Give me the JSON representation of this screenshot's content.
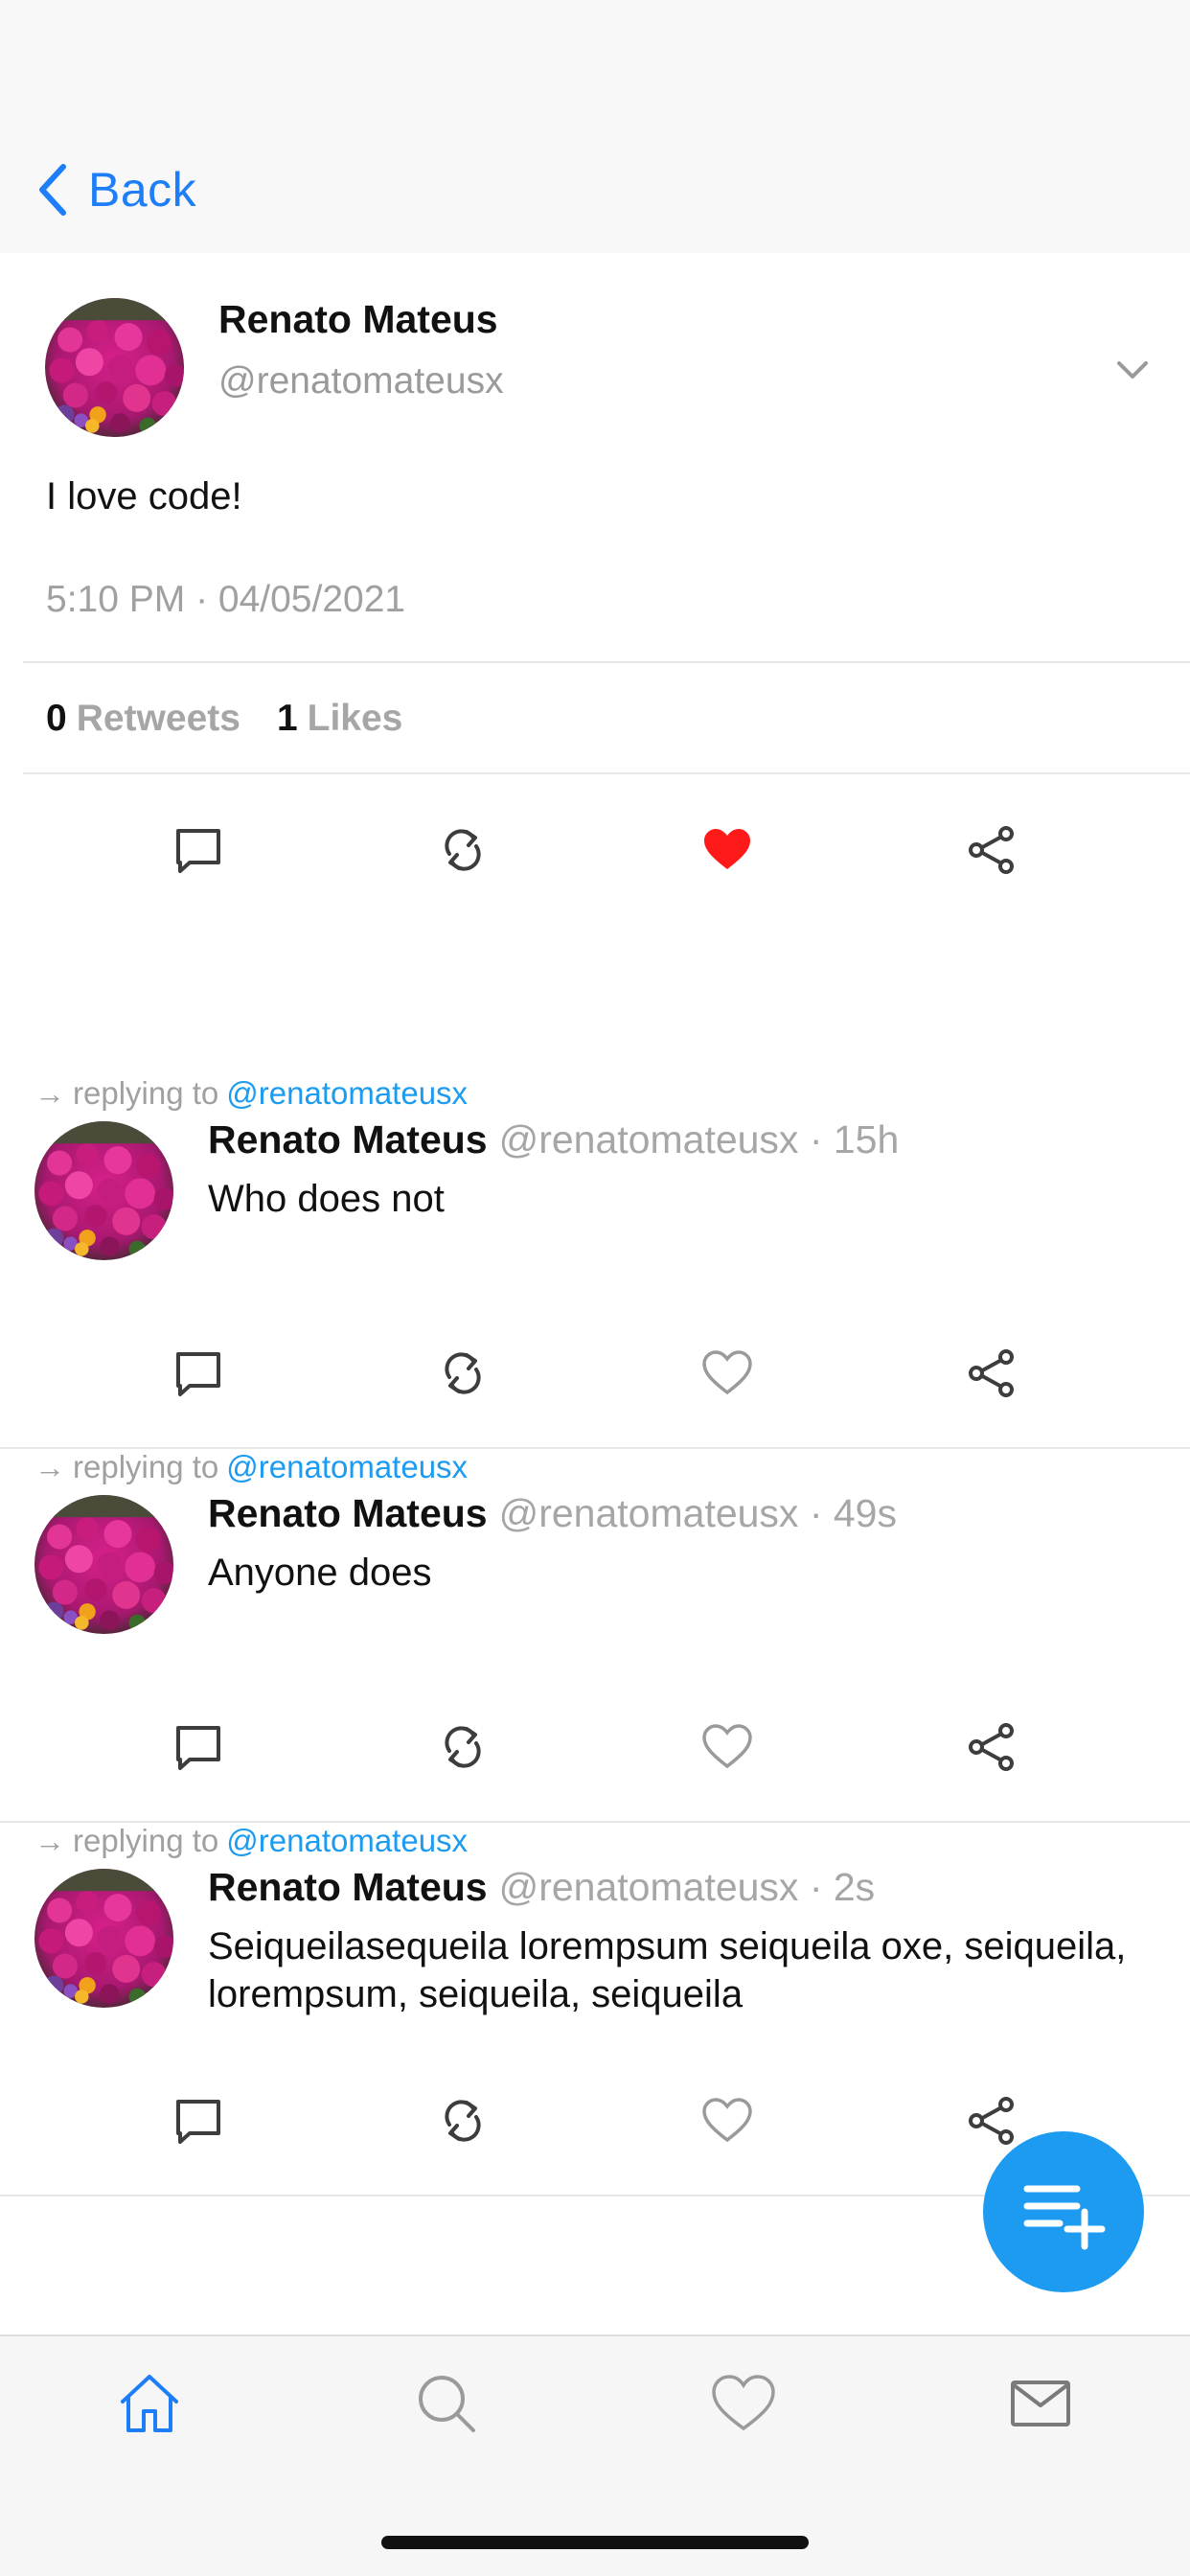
{
  "nav": {
    "back_label": "Back"
  },
  "main_tweet": {
    "author_name": "Renato Mateus",
    "author_handle": "@renatomateusx",
    "text": "I love code!",
    "timestamp": "5:10 PM · 04/05/2021",
    "stats": {
      "retweets_count": "0",
      "retweets_label": "Retweets",
      "likes_count": "1",
      "likes_label": "Likes"
    },
    "liked": true,
    "like_color": "#ff1a1a"
  },
  "replies": [
    {
      "replying_prefix": "replying to",
      "replying_to": "@renatomateusx",
      "author_name": "Renato Mateus",
      "meta": "@renatomateusx · 15h",
      "text": "Who does not"
    },
    {
      "replying_prefix": "replying to",
      "replying_to": "@renatomateusx",
      "author_name": "Renato Mateus",
      "meta": "@renatomateusx · 49s",
      "text": "Anyone does"
    },
    {
      "replying_prefix": "replying to",
      "replying_to": "@renatomateusx",
      "author_name": "Renato Mateus",
      "meta": "@renatomateusx · 2s",
      "text": "Seiqueilasequeila lorempsum seiqueila oxe, seiqueila, lorempsum, seiqueila, seiqueila"
    }
  ],
  "icons": {
    "back": "chevron-left-icon",
    "more": "chevron-down-icon",
    "reply": "comment-icon",
    "retweet": "retweet-icon",
    "like": "heart-icon",
    "share": "share-icon",
    "compose": "compose-list-plus-icon",
    "tabs": [
      "home-icon",
      "search-icon",
      "heart-icon",
      "mail-icon"
    ]
  },
  "colors": {
    "accent": "#1d9bf0",
    "link_blue": "#1d7ef7",
    "muted_text": "#a0a0a0",
    "like_red": "#ff1a1a",
    "active_tab": "#1d7ef7"
  }
}
